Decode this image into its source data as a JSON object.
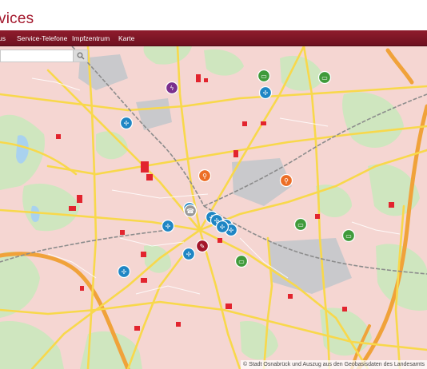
{
  "header": {
    "brand_text": "vices"
  },
  "nav": {
    "items": [
      {
        "label": "us"
      },
      {
        "label": "Service-Telefone"
      },
      {
        "label": "Impfzentrum"
      },
      {
        "label": "Karte"
      }
    ]
  },
  "search": {
    "value": "",
    "placeholder": ""
  },
  "map": {
    "attribution": "© Stadt Osnabrück und Auszug aus den Geobasisdaten des Landesamts",
    "colors": {
      "urban": "#f5d6d2",
      "forest": "#cfe6bf",
      "major_road": "#f8d84b",
      "highway": "#f0a23a",
      "rail": "#8c8c8c",
      "industrial": "#c9c9cc",
      "water": "#a9d2ef",
      "buildings": "#e2242e"
    },
    "markers": [
      {
        "type": "electric-car-charger",
        "color": "#7b2f8e"
      },
      {
        "type": "bus-station",
        "color": "#3f9a3a"
      },
      {
        "type": "bus-station",
        "color": "#3f9a3a"
      },
      {
        "type": "wind-turbine",
        "color": "#1f86c4"
      },
      {
        "type": "wind-turbine",
        "color": "#1f86c4"
      },
      {
        "type": "bicycle-rental",
        "color": "#ec6e26"
      },
      {
        "type": "bicycle-rental",
        "color": "#ec6e26"
      },
      {
        "type": "wind-turbine",
        "color": "#1f86c4"
      },
      {
        "type": "service-telephone",
        "color": "#9a9a9a"
      },
      {
        "type": "wind-turbine",
        "color": "#1f86c4"
      },
      {
        "type": "wind-turbine",
        "color": "#1f86c4"
      },
      {
        "type": "wind-turbine",
        "color": "#1f86c4"
      },
      {
        "type": "wind-turbine",
        "color": "#1f86c4"
      },
      {
        "type": "wind-turbine",
        "color": "#1f86c4"
      },
      {
        "type": "wind-turbine",
        "color": "#1f86c4"
      },
      {
        "type": "vaccination-centre",
        "color": "#a3162b"
      },
      {
        "type": "wind-turbine",
        "color": "#1f86c4"
      },
      {
        "type": "wind-turbine",
        "color": "#1f86c4"
      },
      {
        "type": "bus-station",
        "color": "#3f9a3a"
      },
      {
        "type": "bus-station",
        "color": "#3f9a3a"
      },
      {
        "type": "bus-station",
        "color": "#3f9a3a"
      }
    ]
  }
}
